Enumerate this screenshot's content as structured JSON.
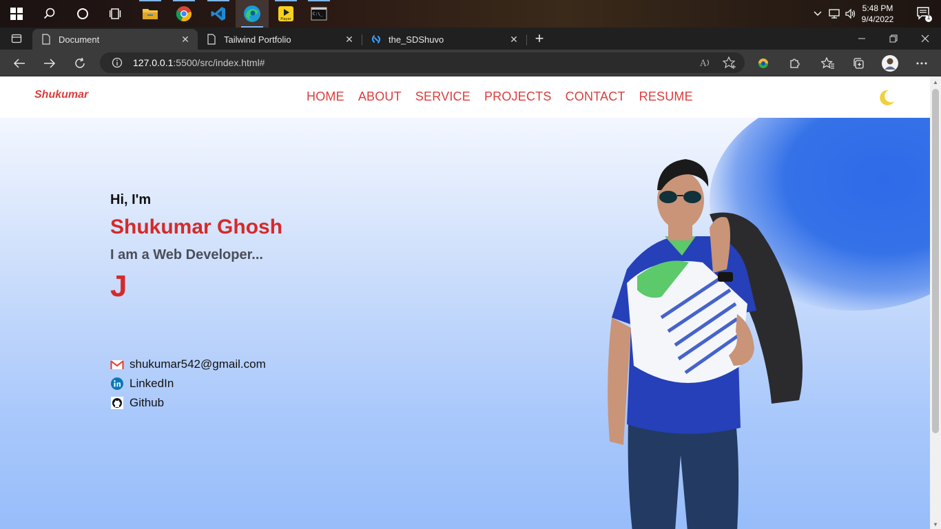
{
  "taskbar": {
    "apps": [
      "start-icon",
      "search-icon",
      "cortana-icon",
      "task-view-icon",
      "file-explorer-icon",
      "chrome-icon",
      "vscode-icon",
      "edge-icon",
      "player-icon",
      "terminal-icon"
    ],
    "player_label": "Player",
    "clock": {
      "time": "5:48 PM",
      "date": "9/4/2022"
    },
    "notification_count": "1"
  },
  "browser": {
    "tabs": [
      {
        "title": "Document",
        "active": true
      },
      {
        "title": "Tailwind Portfolio",
        "active": false
      },
      {
        "title": "the_SDShuvo",
        "active": false
      }
    ],
    "new_tab_label": "+",
    "url_host": "127.0.0.1",
    "url_rest": ":5500/src/index.html#"
  },
  "site": {
    "logo": "Shukumar",
    "nav": [
      "HOME",
      "ABOUT",
      "SERVICE",
      "PROJECTS",
      "CONTACT",
      "RESUME"
    ],
    "greeting": "Hi, I'm",
    "name": "Shukumar Ghosh",
    "role": "I am a Web Developer...",
    "typed_text": "J",
    "contacts": {
      "email": "shukumar542@gmail.com",
      "linkedin": "LinkedIn",
      "github": "Github"
    }
  },
  "colors": {
    "accent": "#dc3c3c",
    "blob": "#2f6ae8",
    "moon": "#f2cf3c"
  }
}
